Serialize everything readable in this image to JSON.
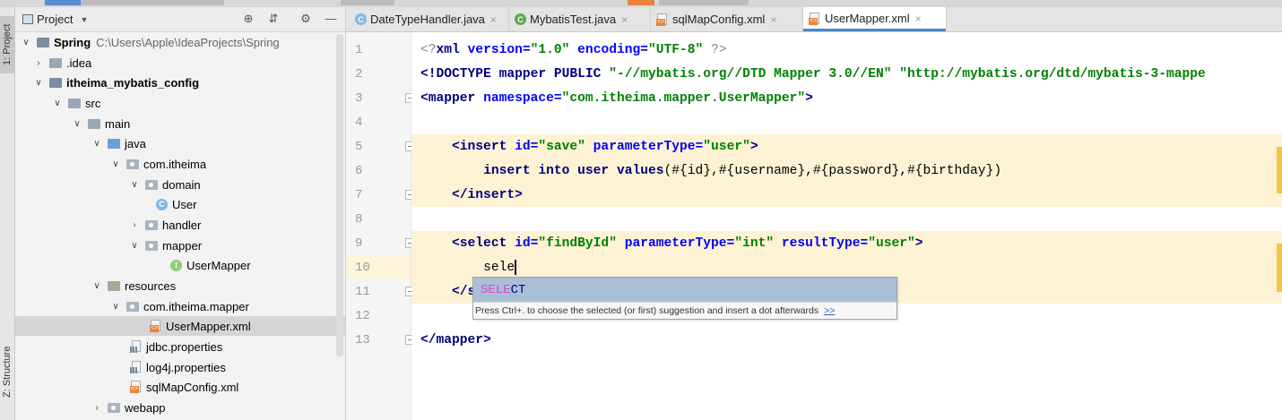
{
  "toolwindow": {
    "project_tab": "1: Project",
    "structure_tab": "Z: Structure"
  },
  "project_panel": {
    "title": "Project",
    "tree": [
      {
        "label": "Spring",
        "path": "C:\\Users\\Apple\\IdeaProjects\\Spring"
      },
      {
        "label": ".idea"
      },
      {
        "label": "itheima_mybatis_config"
      },
      {
        "label": "src"
      },
      {
        "label": "main"
      },
      {
        "label": "java"
      },
      {
        "label": "com.itheima"
      },
      {
        "label": "domain"
      },
      {
        "label": "User"
      },
      {
        "label": "handler"
      },
      {
        "label": "mapper"
      },
      {
        "label": "UserMapper"
      },
      {
        "label": "resources"
      },
      {
        "label": "com.itheima.mapper"
      },
      {
        "label": "UserMapper.xml"
      },
      {
        "label": "jdbc.properties"
      },
      {
        "label": "log4j.properties"
      },
      {
        "label": "sqlMapConfig.xml"
      },
      {
        "label": "webapp"
      }
    ]
  },
  "editor": {
    "tabs": [
      {
        "label": "DateTypeHandler.java"
      },
      {
        "label": "MybatisTest.java"
      },
      {
        "label": "sqlMapConfig.xml"
      },
      {
        "label": "UserMapper.xml"
      }
    ],
    "line_numbers": [
      "1",
      "2",
      "3",
      "4",
      "5",
      "6",
      "7",
      "8",
      "9",
      "10",
      "11",
      "12",
      "13"
    ],
    "code": {
      "l1_open": "<?",
      "l1_tag": "xml",
      "l1_attr1": " version=",
      "l1_val1": "\"1.0\"",
      "l1_attr2": " encoding=",
      "l1_val2": "\"UTF-8\"",
      "l1_close": " ?>",
      "l2_tag": "<!DOCTYPE mapper PUBLIC ",
      "l2_val1": "\"-//mybatis.org//DTD Mapper 3.0//EN\"",
      "l2_val2": " \"http://mybatis.org/dtd/mybatis-3-mappe",
      "l3_tag": "<mapper",
      "l3_attr": " namespace=",
      "l3_val": "\"com.itheima.mapper.UserMapper\"",
      "l3_close": ">",
      "l5_indent": "    ",
      "l5_tag": "<insert",
      "l5_attr1": " id=",
      "l5_val1": "\"save\"",
      "l5_attr2": " parameterType=",
      "l5_val2": "\"user\"",
      "l5_close": ">",
      "l6_indent": "        ",
      "l6_kw": "insert into user values",
      "l6_rest": "(#{id},#{username},#{password},#{birthday})",
      "l7_indent": "    ",
      "l7_tag": "</insert>",
      "l9_indent": "    ",
      "l9_tag": "<select",
      "l9_attr1": " id=",
      "l9_val1": "\"findById\"",
      "l9_attr2": " parameterType=",
      "l9_val2": "\"int\"",
      "l9_attr3": " resultType=",
      "l9_val3": "\"user\"",
      "l9_close": ">",
      "l10_indent": "        ",
      "l10_text": "sele",
      "l11_indent": "    ",
      "l11_tag": "</s",
      "l13_tag": "</mapper>"
    },
    "completion": {
      "match": "SELE",
      "rest": "CT",
      "hint": "Press Ctrl+. to choose the selected (or first) suggestion and insert a dot afterwards",
      "hint_link": ">>"
    }
  },
  "colors": {
    "highlight_line": "#fdf3d4",
    "tab_underline": "#4a88c7",
    "popup_selected": "#a9bfd6",
    "xml_tag": "#000080",
    "xml_value": "#008000",
    "xml_attr": "#0000ff"
  }
}
